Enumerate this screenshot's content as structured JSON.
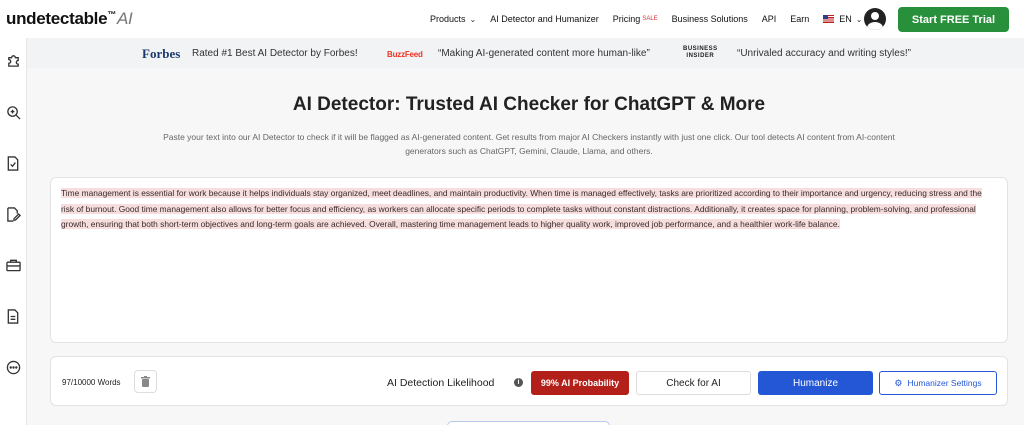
{
  "nav": {
    "logo_main": "undetectable",
    "logo_tm": "™",
    "logo_ai": "AI",
    "items": [
      {
        "label": "Products",
        "has_caret": true
      },
      {
        "label": "AI Detector and Humanizer"
      },
      {
        "label": "Pricing",
        "badge": "SALE"
      },
      {
        "label": "Business Solutions"
      },
      {
        "label": "API"
      },
      {
        "label": "Earn"
      }
    ],
    "language": "EN",
    "cta_label": "Start FREE Trial",
    "cta_color": "#28903b"
  },
  "sidebar": {
    "icons": [
      "puzzle-icon",
      "search-zoom-icon",
      "document-check-icon",
      "edit-document-icon",
      "briefcase-icon",
      "document-text-icon",
      "more-icon"
    ]
  },
  "press": {
    "forbes_logo": "Forbes",
    "forbes_quote": "Rated #1 Best AI Detector by Forbes!",
    "buzzfeed_logo": "BuzzFeed",
    "buzzfeed_quote": "“Making AI-generated content more human-like”",
    "bi_logo_line1": "BUSINESS",
    "bi_logo_line2": "INSIDER",
    "bi_quote": "“Unrivaled accuracy and writing styles!”"
  },
  "main": {
    "title": "AI Detector: Trusted AI Checker for ChatGPT & More",
    "subtitle": "Paste your text into our AI Detector to check if it will be flagged as AI-generated content. Get results from major AI Checkers instantly with just one click. Our tool detects AI content from AI-content generators such as ChatGPT, Gemini, Claude, Llama, and others.",
    "editor_text": "Time management is essential for work because it helps individuals stay organized, meet deadlines, and maintain productivity. When time is managed effectively, tasks are prioritized according to their importance and urgency, reducing stress and the risk of burnout. Good time management also allows for better focus and efficiency, as workers can allocate specific periods to complete tasks without constant distractions. Additionally, it creates space for planning, problem-solving, and professional growth, ensuring that both short-term objectives and long-term goals are achieved. Overall, mastering time management leads to higher quality work, improved job performance, and a healthier work-life balance."
  },
  "bottombar": {
    "word_count": "97/10000 Words",
    "likelihood_label": "AI Detection Likelihood",
    "probability_label": "99% AI Probability",
    "check_label": "Check for AI",
    "humanize_label": "Humanize",
    "settings_label": "Humanizer Settings",
    "probability_color": "#b3201a",
    "humanize_color": "#2457d6"
  }
}
